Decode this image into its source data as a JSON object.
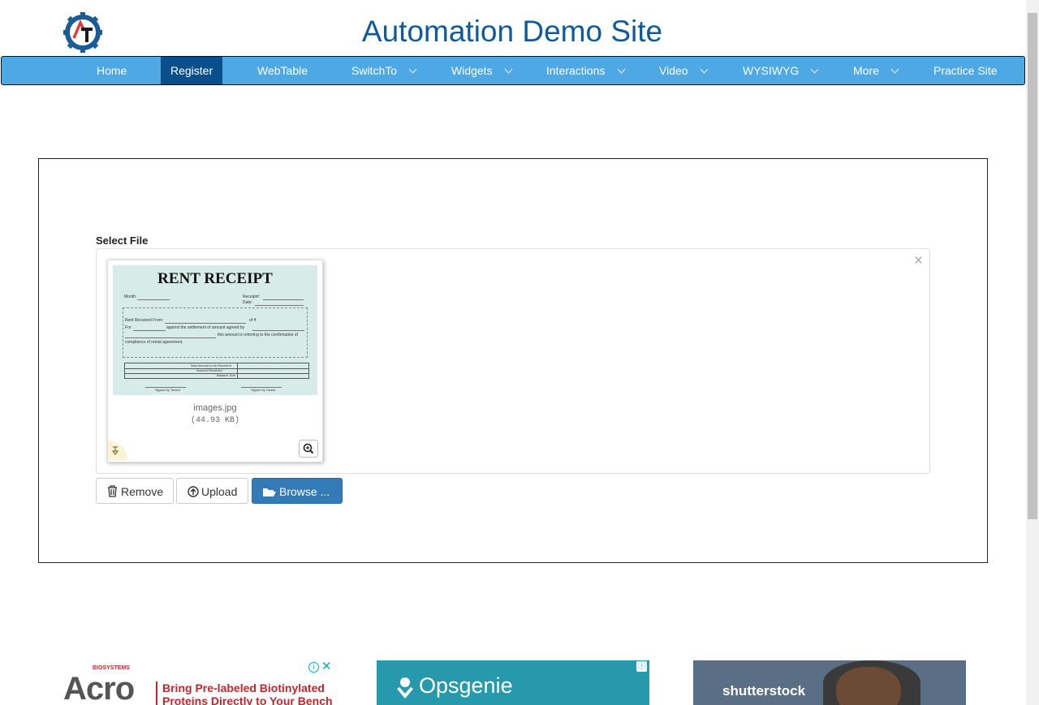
{
  "site": {
    "title": "Automation Demo Site"
  },
  "nav": {
    "items": [
      {
        "label": "Home"
      },
      {
        "label": "Register"
      },
      {
        "label": "WebTable"
      },
      {
        "label": "SwitchTo"
      },
      {
        "label": "Widgets"
      },
      {
        "label": "Interactions"
      },
      {
        "label": "Video"
      },
      {
        "label": "WYSIWYG"
      },
      {
        "label": "More"
      },
      {
        "label": "Practice Site"
      }
    ]
  },
  "upload": {
    "label": "Select File",
    "file": {
      "name": "images.jpg",
      "size": "(44.93 KB)"
    },
    "preview": {
      "title": "RENT RECEIPT",
      "month": "Month:",
      "receipt_no": "Receipt#:",
      "date": "Date:",
      "rent_from": "Rent Received From:",
      "rent_amount": "of ₹",
      "for": "For",
      "against": "against the settlement of amount agreed by",
      "refer": "this amount is referring to the confirmation of",
      "compliance": "compliance of rental agreement.",
      "row1": "Total Amount to be Received",
      "row2": "Amount Received",
      "row3": "Balance Due",
      "sign_tenant": "Signed by Tenant",
      "sign_owner": "Signed by Owner"
    },
    "buttons": {
      "remove": "Remove",
      "upload": "Upload",
      "browse": "Browse ..."
    }
  },
  "ads": {
    "ad1": {
      "brand": "Acro",
      "brand_sub": "BIOSYSTEMS",
      "text_line1": "Bring Pre-labeled Biotinylated",
      "text_line2": "Proteins Directly to Your Bench"
    },
    "ad2": {
      "brand": "Opsgenie"
    },
    "ad3": {
      "brand": "shutterstock"
    }
  },
  "colors": {
    "nav_bg": "#4ea8e4",
    "nav_active": "#0a4f8c",
    "title": "#0f5a9c",
    "primary_button": "#337ab7"
  }
}
